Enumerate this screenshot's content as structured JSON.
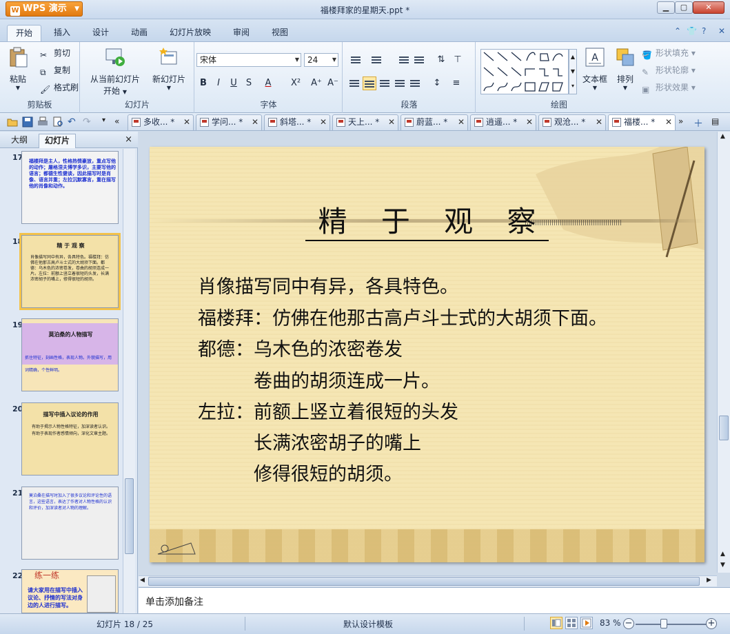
{
  "app": {
    "menu_button": "WPS 演示",
    "window_title": "福楼拜家的星期天.ppt *"
  },
  "ribbon_tabs": [
    "开始",
    "插入",
    "设计",
    "动画",
    "幻灯片放映",
    "审阅",
    "视图"
  ],
  "ribbon": {
    "clipboard": {
      "paste": "粘贴",
      "cut": "剪切",
      "copy": "复制",
      "format_painter": "格式刷",
      "label": "剪贴板"
    },
    "slides": {
      "from_current": "从当前幻灯片",
      "start": "开始",
      "new_slide": "新幻灯片",
      "label": "幻灯片"
    },
    "font": {
      "name": "宋体",
      "size": "24",
      "bold": "B",
      "italic": "I",
      "underline": "U",
      "shadow": "S",
      "color": "A",
      "superscript": "X²",
      "grow": "A⁺",
      "shrink": "A⁻",
      "label": "字体"
    },
    "paragraph": {
      "label": "段落"
    },
    "drawing": {
      "textbox": "文本框",
      "arrange": "排列",
      "shape_fill": "形状填充",
      "shape_outline": "形状轮廓",
      "shape_effect": "形状效果",
      "label": "绘图"
    }
  },
  "doc_tabs": [
    {
      "label": "多收... *"
    },
    {
      "label": "学问... *"
    },
    {
      "label": "斜塔... *"
    },
    {
      "label": "天上... *"
    },
    {
      "label": "蔚蓝... *"
    },
    {
      "label": "逍遥... *"
    },
    {
      "label": "观沧... *"
    },
    {
      "label": "福楼... *"
    }
  ],
  "left_panel": {
    "tabs": [
      "大纲",
      "幻灯片"
    ],
    "close": "×",
    "thumbnails": [
      {
        "num": "17",
        "text": "福楼拜是主人，性格热情豪放，重点写他的动作；屠格涅夫博学多识，主要写他的语言；都德生性健谈，因此描写时是肖像、语言并重；左拉沉默寡言，重在描写他的肖像和动作。"
      },
      {
        "num": "18",
        "title": "精 于 观 察",
        "text": "肖像描写同中有异，各具特色。福楼拜：仿佛在他那古高卢斗士式的大胡须下面。都德：乌木色的浓密卷发，卷曲的胡须连成一片。左拉：前额上竖立着很短的头发，长满浓密胡子的嘴上，修得很短的胡须。"
      },
      {
        "num": "19",
        "title": "莫泊桑的人物描写",
        "text": "抓住特征，刻画性格，表现人物。外貌描写，用词精确，个性鲜明。"
      },
      {
        "num": "20",
        "title": "描写中插入议论的作用",
        "text": "有助于揭示人物性格特征，加深读者认识。有助于表现作者感情倾向，深化文章主题。"
      },
      {
        "num": "21",
        "text": "莫泊桑在描写时加入了很多议论和评论性的语言，这些语言，表达了作者对人物性格的认识和评价，加深读者对人物的理解。"
      },
      {
        "num": "22",
        "title": "练一练",
        "text": "请大家用在描写中插入议论、抒情的写法对身边的人进行描写。"
      }
    ]
  },
  "slide": {
    "title": "精 于 观 察",
    "lines": [
      "肖像描写同中有异，各具特色。",
      "福楼拜：仿佛在他那古高卢斗士式的大胡须下面。",
      "都德：乌木色的浓密卷发",
      "　　　卷曲的胡须连成一片。",
      "左拉：前额上竖立着很短的头发",
      "　　　长满浓密胡子的嘴上",
      "　　　修得很短的胡须。"
    ]
  },
  "notes_placeholder": "单击添加备注",
  "status": {
    "slide_pos": "幻灯片 18 / 25",
    "template": "默认设计模板",
    "zoom": "83 %"
  }
}
